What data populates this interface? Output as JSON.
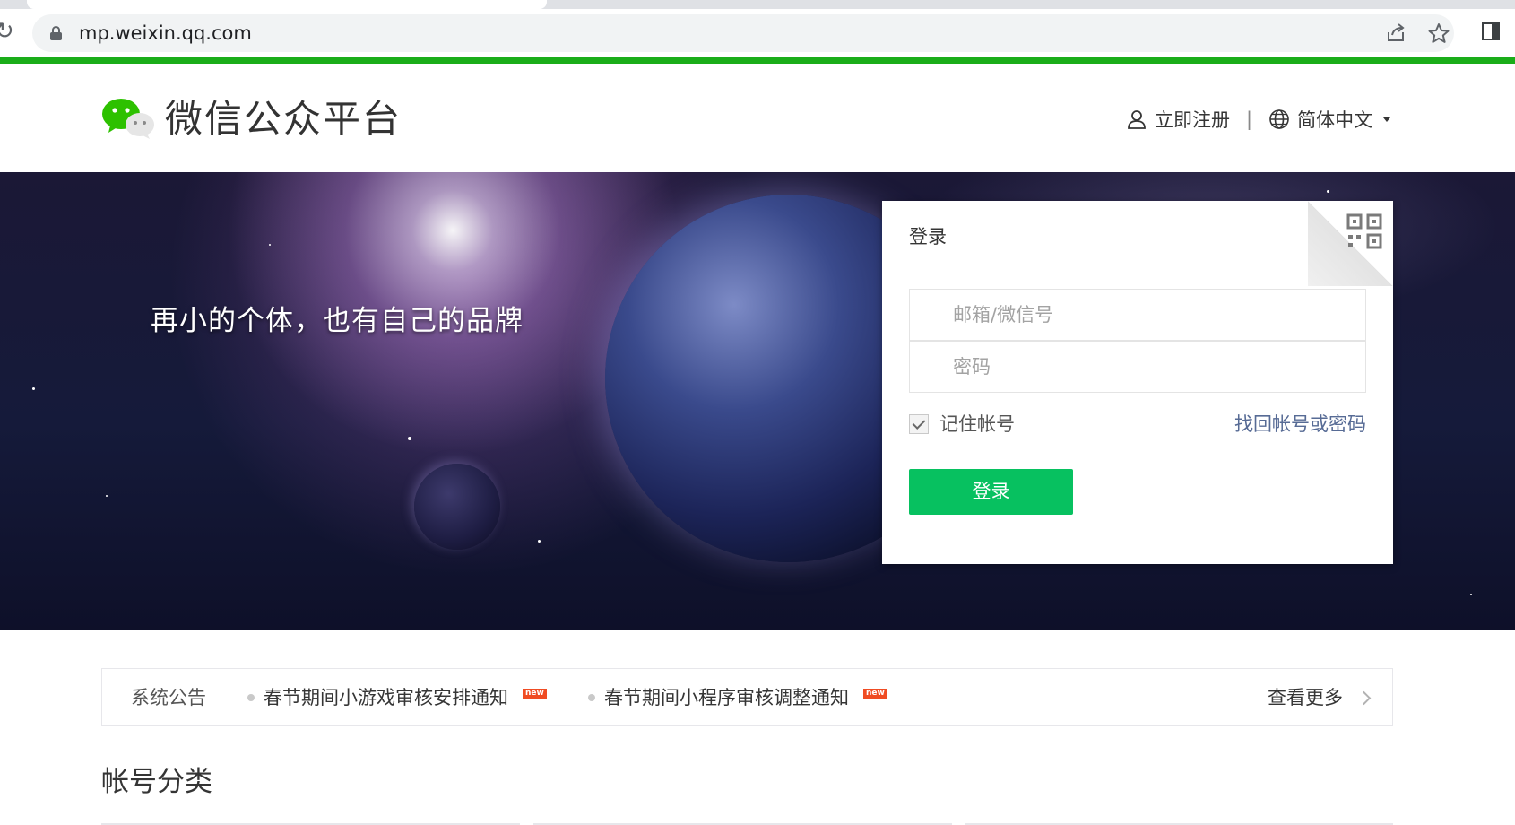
{
  "browser": {
    "url": "mp.weixin.qq.com"
  },
  "header": {
    "brand": "微信公众平台",
    "register_label": "立即注册",
    "separator": "|",
    "language_label": "简体中文"
  },
  "banner": {
    "slogan": "再小的个体，也有自己的品牌"
  },
  "login": {
    "title": "登录",
    "account_placeholder": "邮箱/微信号",
    "password_placeholder": "密码",
    "remember_label": "记住帐号",
    "remember_checked": true,
    "forgot_link": "找回帐号或密码",
    "submit_label": "登录"
  },
  "notice": {
    "title": "系统公告",
    "items": [
      {
        "text": "春节期间小游戏审核安排通知",
        "badge": "new"
      },
      {
        "text": "春节期间小程序审核调整通知",
        "badge": "new"
      }
    ],
    "more_label": "查看更多"
  },
  "accounts": {
    "title": "帐号分类"
  },
  "colors": {
    "brand_green": "#1aad19",
    "button_green": "#07c160",
    "link_blue": "#576b95",
    "badge_red": "#f04c23"
  }
}
